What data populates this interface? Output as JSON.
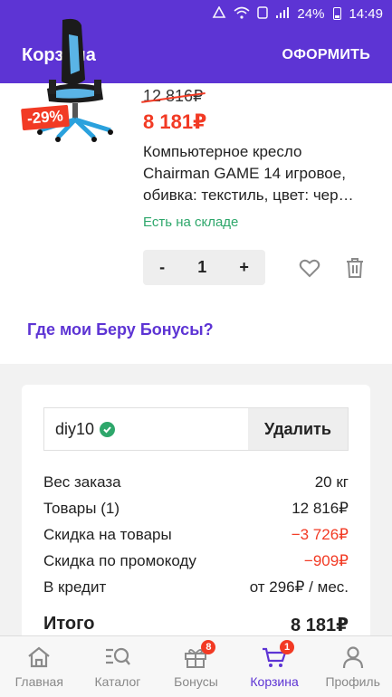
{
  "status_bar": {
    "battery": "24%",
    "time": "14:49",
    "icons": [
      "recycle-icon",
      "wifi-icon",
      "sim-icon",
      "signal-icon",
      "battery-icon"
    ]
  },
  "app_bar": {
    "title": "Корзина",
    "action_label": "ОФОРМИТЬ"
  },
  "product": {
    "image_icon": "gaming-chair-image",
    "discount_badge": "-29%",
    "old_price": "12 816₽",
    "price": "8 181₽",
    "title_line1": "Компьютерное кресло",
    "title_line2": "Chairman GAME 14 игровое,",
    "title_line3": "обивка: текстиль, цвет: чер…",
    "stock": "Есть на складе",
    "quantity": "1",
    "minus": "-",
    "plus": "+"
  },
  "bonus_link": "Где мои Беру Бонусы?",
  "promo": {
    "code": "diy10",
    "remove_label": "Удалить"
  },
  "summary": {
    "rows": [
      {
        "label": "Вес заказа",
        "value": "20 кг"
      },
      {
        "label": "Товары (1)",
        "value": "12 816₽"
      },
      {
        "label": "Скидка на товары",
        "value": "−3 726₽"
      },
      {
        "label": "Скидка по промокоду",
        "value": "−909₽"
      },
      {
        "label": "В кредит",
        "value": "от 296₽ / мес."
      }
    ],
    "total_label": "Итого",
    "total_value": "8 181₽"
  },
  "colors": {
    "brand": "#5d34d4",
    "discount_red": "#f23a24",
    "in_stock_green": "#2ea76b"
  },
  "bottom_nav": [
    {
      "label": "Главная",
      "icon": "home-icon"
    },
    {
      "label": "Каталог",
      "icon": "catalog-search-icon"
    },
    {
      "label": "Бонусы",
      "icon": "gift-icon",
      "badge": "8"
    },
    {
      "label": "Корзина",
      "icon": "cart-icon",
      "badge": "1",
      "active": true
    },
    {
      "label": "Профиль",
      "icon": "profile-icon"
    }
  ]
}
